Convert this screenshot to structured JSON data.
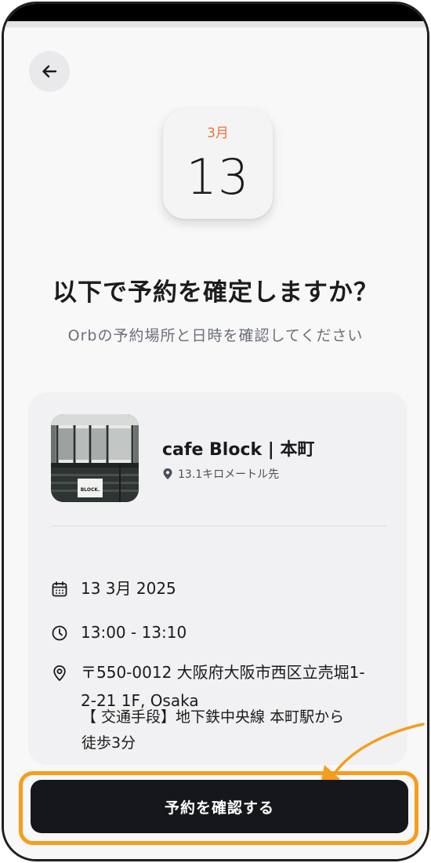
{
  "header": {
    "back_icon": "arrow-left-icon"
  },
  "calendar": {
    "month": "3月",
    "day": "13"
  },
  "title": "以下で予約を確定しますか？",
  "subtitle": "Orbの予約場所と日時を確認してください",
  "venue": {
    "name": "cafe Block | 本町",
    "distance": "13.1キロメートル先",
    "thumb_sign": "BLOCK."
  },
  "details": {
    "date": "13 3月 2025",
    "time": "13:00 - 13:10",
    "address_line1": "〒550-0012 大阪府大阪市西区立売堀1-",
    "address_line2": "2-21 1F, Osaka",
    "transit_line1": "【 交通手段】地下鉄中央線 本町駅から",
    "transit_line2": "徒歩3分"
  },
  "confirm_button": "予約を確認する",
  "colors": {
    "accent_orange": "#f0713a",
    "highlight": "#f59e1d",
    "button_dark": "#15171b"
  }
}
